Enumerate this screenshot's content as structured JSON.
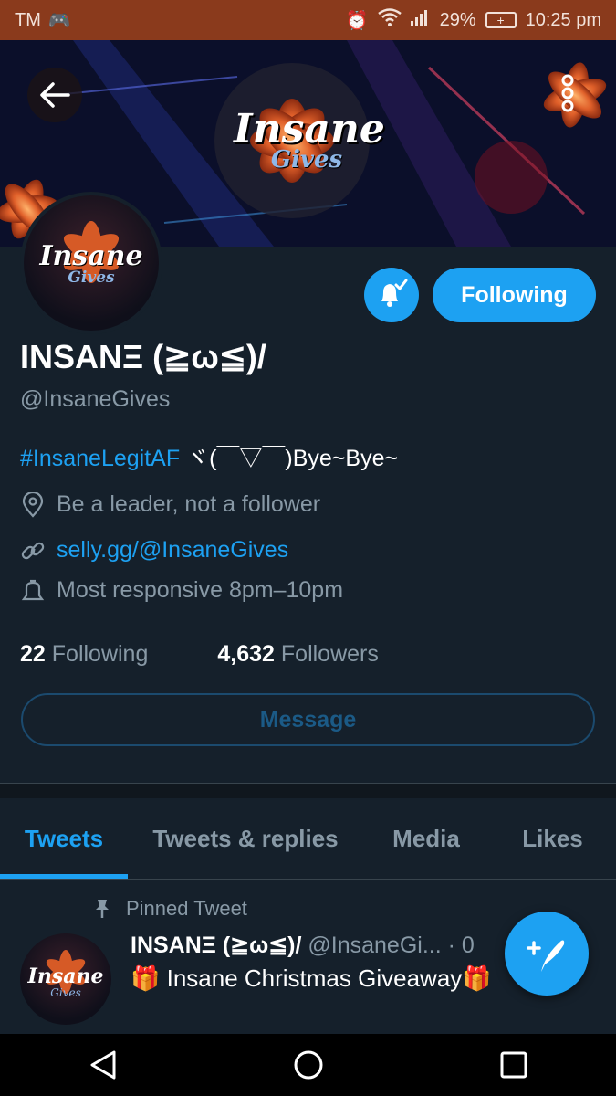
{
  "status_bar": {
    "carrier": "TM",
    "battery_percent": "29%",
    "time": "10:25 pm"
  },
  "banner": {
    "logo_main": "Insane",
    "logo_sub": "Gives"
  },
  "profile": {
    "follow_button_label": "Following",
    "display_name": "INSANΞ (≧ω≦)/",
    "handle": "@InsaneGives",
    "bio_hashtag": "#InsaneLegitAF",
    "bio_text": " ヾ(￣▽￣)Bye~Bye~",
    "location": "Be a leader, not a follower",
    "website": "selly.gg/@InsaneGives",
    "responsiveness": "Most responsive 8pm–10pm",
    "following_count": "22",
    "following_label": "Following",
    "followers_count": "4,632",
    "followers_label": "Followers",
    "message_button_label": "Message"
  },
  "tabs": [
    {
      "label": "Tweets",
      "active": true
    },
    {
      "label": "Tweets & replies",
      "active": false
    },
    {
      "label": "Media",
      "active": false
    },
    {
      "label": "Likes",
      "active": false
    }
  ],
  "pinned_tweet": {
    "pinned_label": "Pinned Tweet",
    "author_name": "INSANΞ (≧ω≦)/",
    "author_handle": "@InsaneGi...",
    "time_fragment": "· 0",
    "text": "🎁 Insane Christmas Giveaway🎁"
  },
  "colors": {
    "background": "#15202b",
    "accent": "#1da1f2",
    "status_bar": "#8a3a1c",
    "muted_text": "#8899a6"
  }
}
